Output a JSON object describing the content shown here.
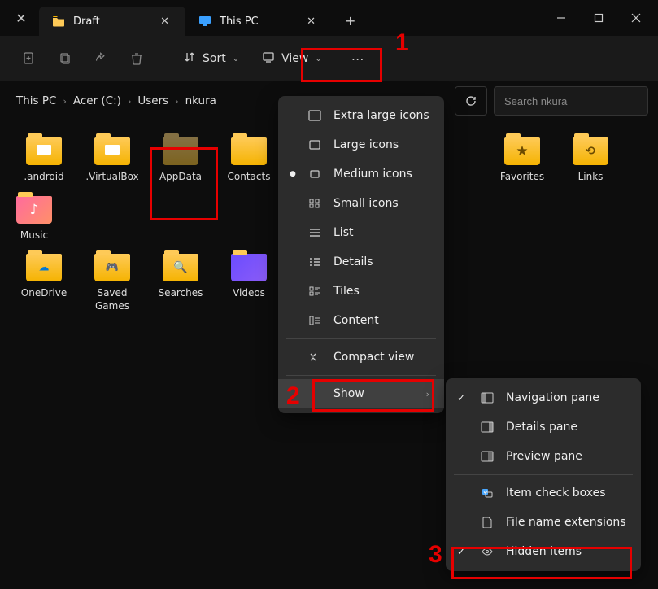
{
  "tabs": [
    {
      "label": "Draft",
      "icon": "folder"
    },
    {
      "label": "This PC",
      "icon": "monitor"
    }
  ],
  "toolbar": {
    "sort_label": "Sort",
    "view_label": "View"
  },
  "breadcrumb": [
    "This PC",
    "Acer (C:)",
    "Users",
    "nkura"
  ],
  "search": {
    "placeholder": "Search nkura"
  },
  "files": [
    {
      "label": ".android",
      "variant": "doc"
    },
    {
      "label": ".VirtualBox",
      "variant": "doc"
    },
    {
      "label": "AppData",
      "variant": "dim"
    },
    {
      "label": "Contacts",
      "variant": "plain"
    },
    {
      "label": "Favorites",
      "variant": "star"
    },
    {
      "label": "Links",
      "variant": "link"
    },
    {
      "label": "Music",
      "variant": "music"
    },
    {
      "label": "OneDrive",
      "variant": "cloud"
    },
    {
      "label": "Saved Games",
      "variant": "game"
    },
    {
      "label": "Searches",
      "variant": "search"
    },
    {
      "label": "Videos",
      "variant": "video"
    }
  ],
  "viewMenu": {
    "items": [
      {
        "label": "Extra large icons",
        "icon": "rect"
      },
      {
        "label": "Large icons",
        "icon": "rect"
      },
      {
        "label": "Medium icons",
        "icon": "rect",
        "selected": true
      },
      {
        "label": "Small icons",
        "icon": "grid4"
      },
      {
        "label": "List",
        "icon": "list"
      },
      {
        "label": "Details",
        "icon": "details"
      },
      {
        "label": "Tiles",
        "icon": "tiles"
      },
      {
        "label": "Content",
        "icon": "content"
      }
    ],
    "compact_label": "Compact view",
    "show_label": "Show"
  },
  "showMenu": {
    "items": [
      {
        "label": "Navigation pane",
        "icon": "navpane",
        "checked": true
      },
      {
        "label": "Details pane",
        "icon": "detailspane",
        "checked": false
      },
      {
        "label": "Preview pane",
        "icon": "previewpane",
        "checked": false
      },
      {
        "label": "Item check boxes",
        "icon": "checkbox",
        "checked": false
      },
      {
        "label": "File name extensions",
        "icon": "fileext",
        "checked": false
      },
      {
        "label": "Hidden items",
        "icon": "hidden",
        "checked": true
      }
    ]
  },
  "annotations": {
    "n1": "1",
    "n2": "2",
    "n3": "3"
  }
}
